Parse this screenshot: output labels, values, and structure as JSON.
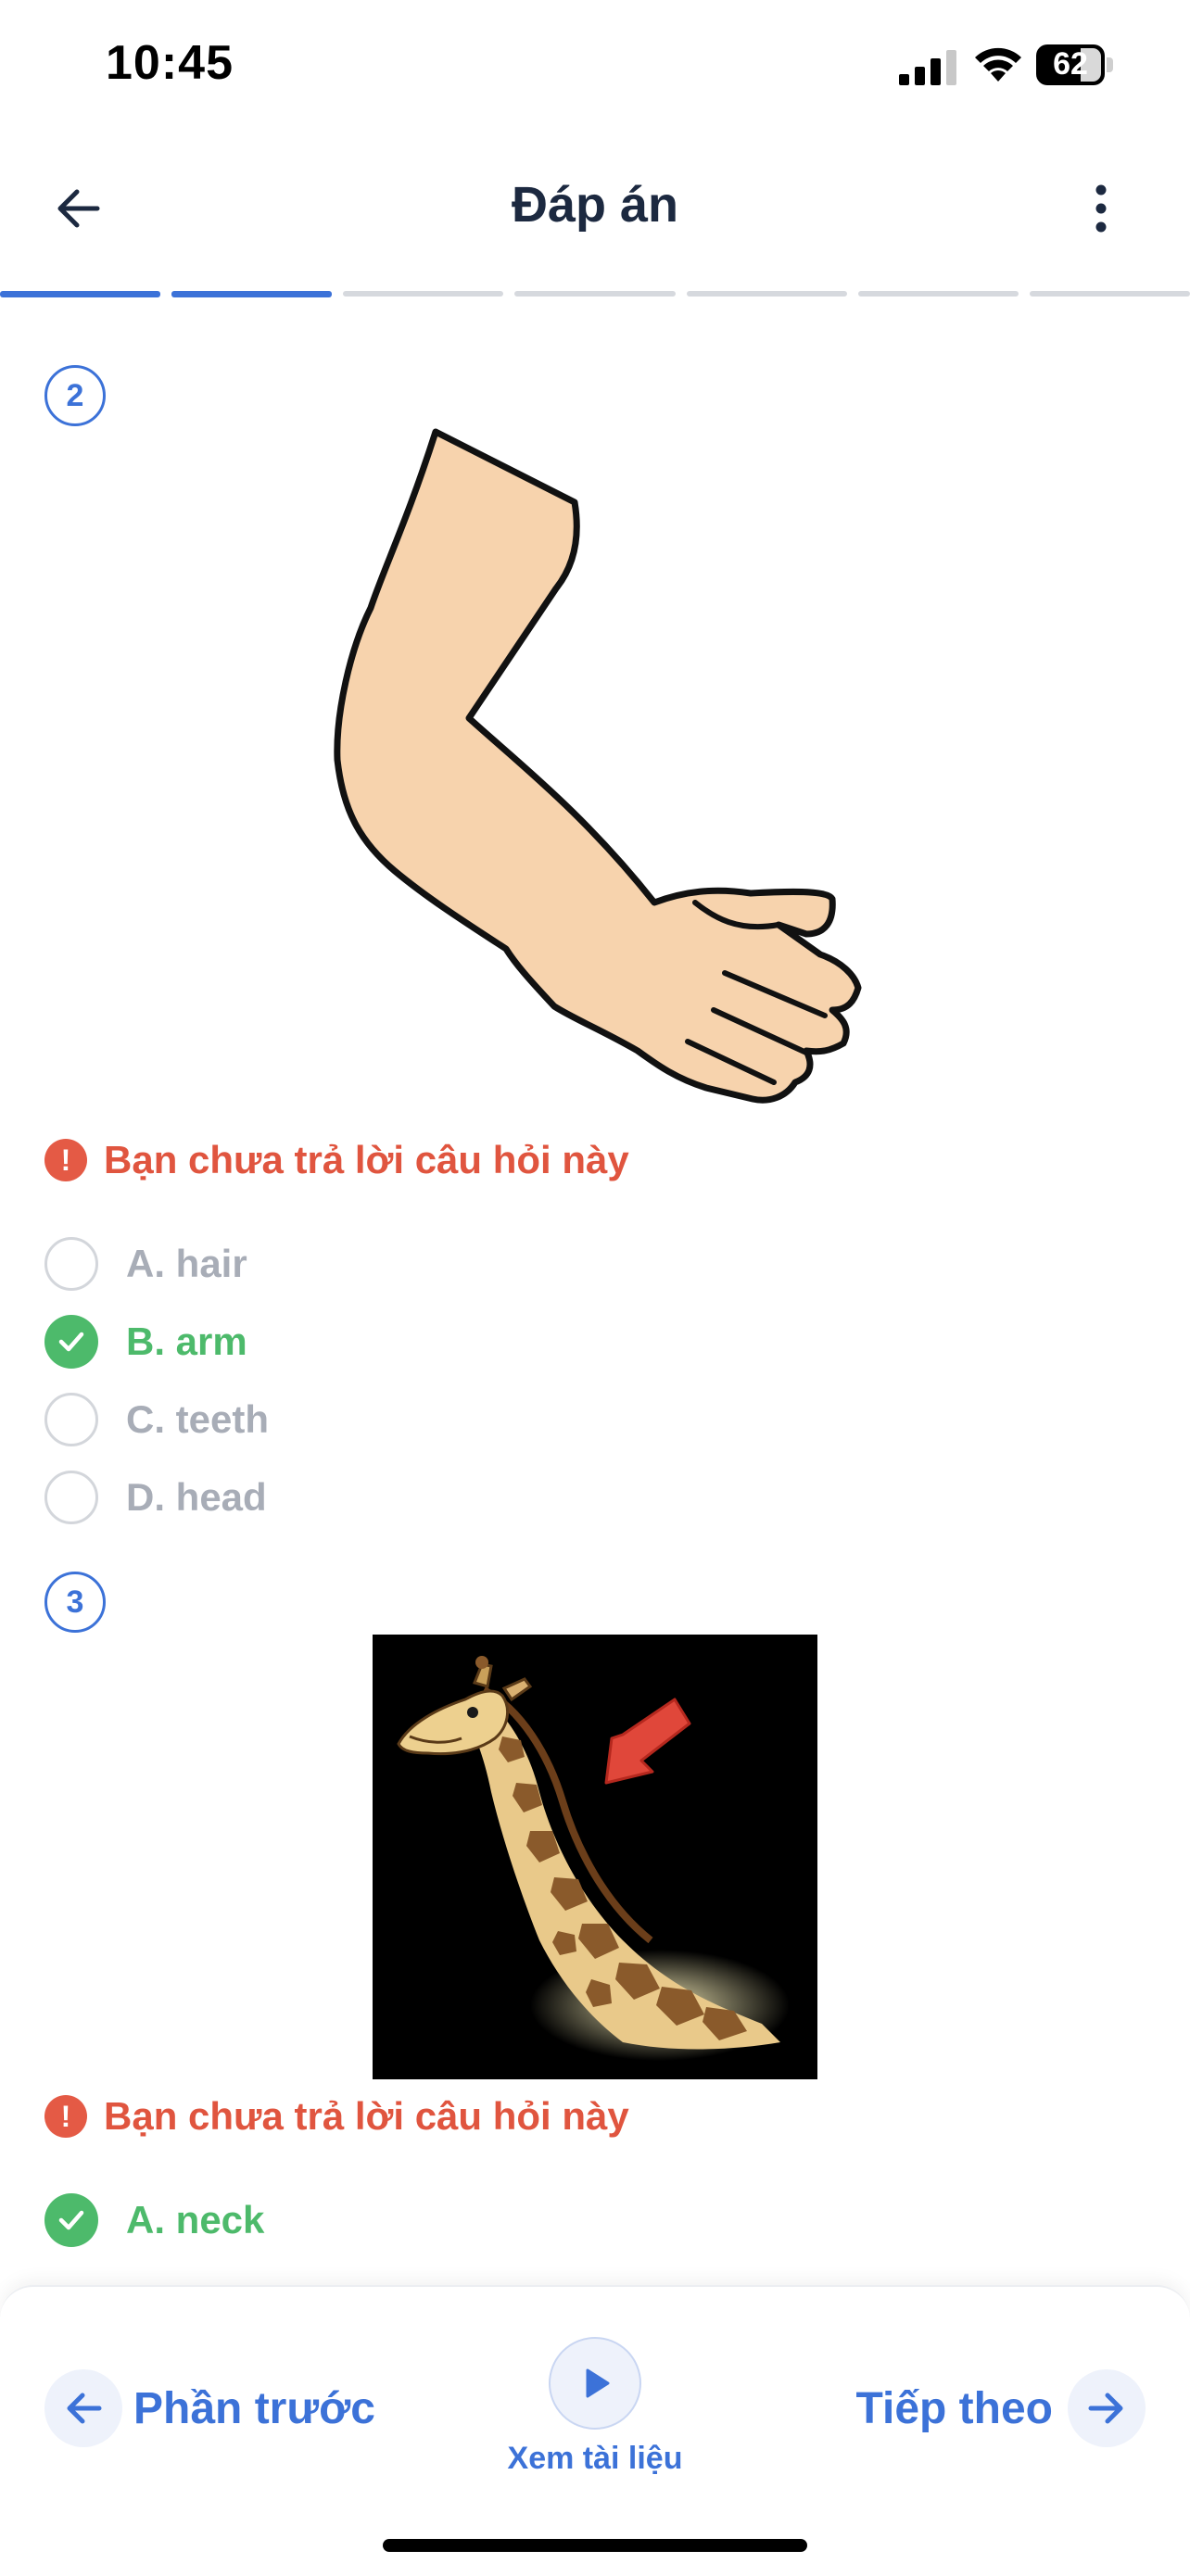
{
  "status_bar": {
    "time": "10:45",
    "battery": "62"
  },
  "header": {
    "title": "Đáp án"
  },
  "progress": {
    "total_segments": 7,
    "completed_segments": 2
  },
  "questions": [
    {
      "number": "2",
      "image": "arm-illustration",
      "warning": "Bạn chưa trả lời câu hỏi này",
      "options": [
        {
          "label": "A. hair",
          "correct": false
        },
        {
          "label": "B. arm",
          "correct": true
        },
        {
          "label": "C. teeth",
          "correct": false
        },
        {
          "label": "D. head",
          "correct": false
        }
      ]
    },
    {
      "number": "3",
      "image": "giraffe-neck-illustration",
      "warning": "Bạn chưa trả lời câu hỏi này",
      "options": [
        {
          "label": "A. neck",
          "correct": true
        }
      ]
    }
  ],
  "bottom_bar": {
    "prev_label": "Phần trước",
    "doc_label": "Xem tài liệu",
    "next_label": "Tiếp theo"
  },
  "colors": {
    "accent": "#3c72d8",
    "correct": "#4dba6b",
    "warning": "#e0553f",
    "muted": "#a8adb7"
  }
}
